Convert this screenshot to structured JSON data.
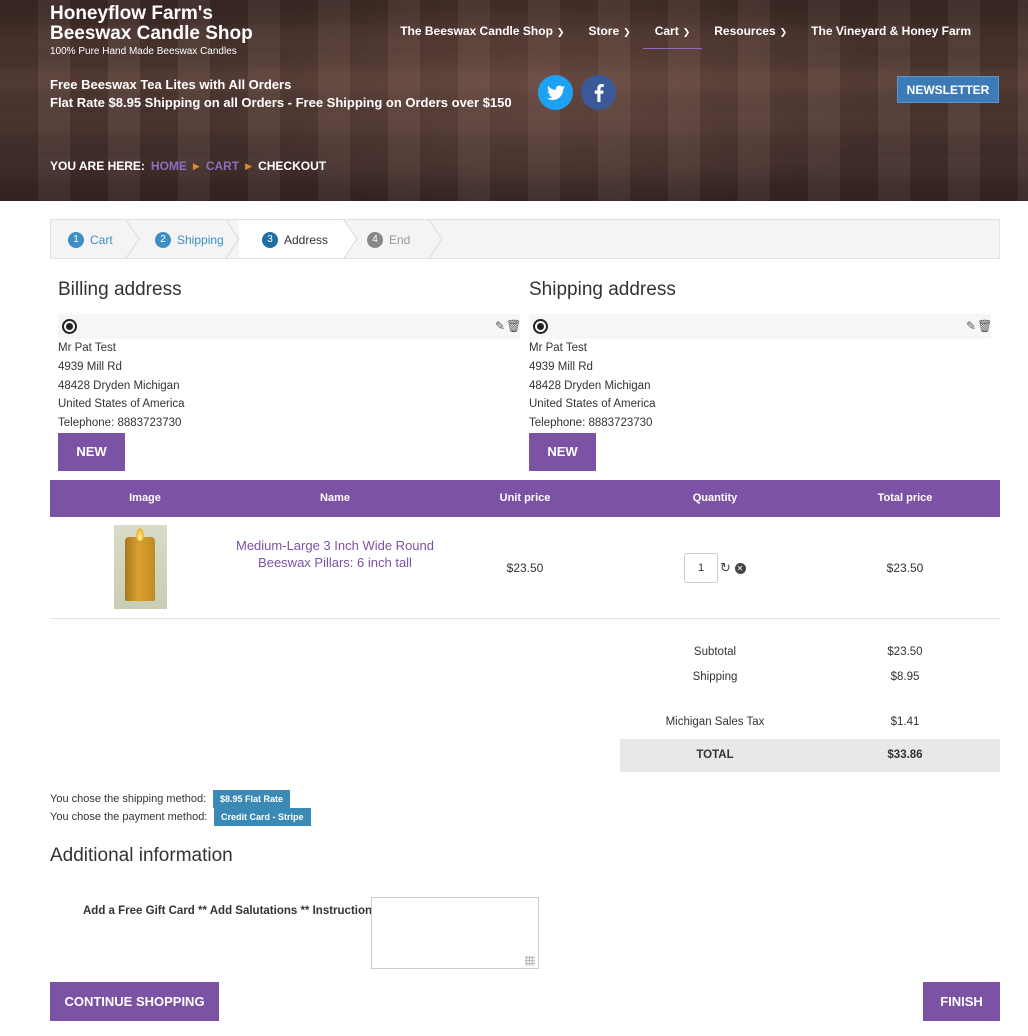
{
  "site": {
    "title_line1": "Honeyflow Farm's",
    "title_line2": "Beeswax Candle Shop",
    "subtitle": "100% Pure Hand Made Beeswax Candles"
  },
  "nav": {
    "items": [
      {
        "label": "The Beeswax Candle Shop",
        "has_dropdown": true
      },
      {
        "label": "Store",
        "has_dropdown": true
      },
      {
        "label": "Cart",
        "has_dropdown": true,
        "active": true
      },
      {
        "label": "Resources",
        "has_dropdown": true
      },
      {
        "label": "The Vineyard & Honey Farm",
        "has_dropdown": false
      }
    ]
  },
  "promo": {
    "line1": "Free Beeswax Tea Lites with All Orders",
    "line2": "Flat Rate $8.95 Shipping on all Orders - Free Shipping on Orders over $150"
  },
  "social": {
    "twitter_icon": "twitter-icon",
    "facebook_icon": "facebook-icon",
    "twitter_color": "#1da1f2",
    "facebook_color": "#3b5998"
  },
  "newsletter_label": "NEWSLETTER",
  "breadcrumb": {
    "prefix": "YOU ARE HERE:",
    "items": [
      "HOME",
      "CART",
      "CHECKOUT"
    ]
  },
  "steps": [
    {
      "num": "1",
      "label": "Cart"
    },
    {
      "num": "2",
      "label": "Shipping"
    },
    {
      "num": "3",
      "label": "Address"
    },
    {
      "num": "4",
      "label": "End"
    }
  ],
  "billing": {
    "title": "Billing address",
    "lines": [
      "Mr Pat Test",
      "4939 Mill Rd",
      "48428 Dryden Michigan",
      "United States of America",
      "Telephone: 8883723730"
    ],
    "new_label": "NEW"
  },
  "shipping": {
    "title": "Shipping address",
    "lines": [
      "Mr Pat Test",
      "4939 Mill Rd",
      "48428 Dryden Michigan",
      "United States of America",
      "Telephone: 8883723730"
    ],
    "new_label": "NEW"
  },
  "table": {
    "headers": [
      "Image",
      "Name",
      "Unit price",
      "Quantity",
      "Total price"
    ],
    "rows": [
      {
        "name": "Medium-Large 3 Inch Wide Round Beeswax Pillars: 6 inch tall",
        "unit_price": "$23.50",
        "quantity": "1",
        "total_price": "$23.50"
      }
    ]
  },
  "summary": {
    "subtotal_label": "Subtotal",
    "subtotal": "$23.50",
    "shipping_label": "Shipping",
    "shipping": "$8.95",
    "tax_label": "Michigan Sales Tax",
    "tax": "$1.41",
    "total_label": "TOTAL",
    "total": "$33.86"
  },
  "methods": {
    "shipping_text": "You chose the shipping method:",
    "shipping_badge": "$8.95 Flat Rate",
    "payment_text": "You chose the payment method:",
    "payment_badge": "Credit Card - Stripe"
  },
  "additional": {
    "title": "Additional information",
    "gift_label": "Add a Free Gift Card ** Add Salutations ** Instructions",
    "gift_value": ""
  },
  "buttons": {
    "continue": "CONTINUE SHOPPING",
    "finish": "FINISH"
  },
  "colors": {
    "purple": "#7c52a5",
    "step_blue": "#3d8fc4",
    "badge_blue": "#3a8ab5",
    "newsletter_blue": "#3d7ab8"
  }
}
